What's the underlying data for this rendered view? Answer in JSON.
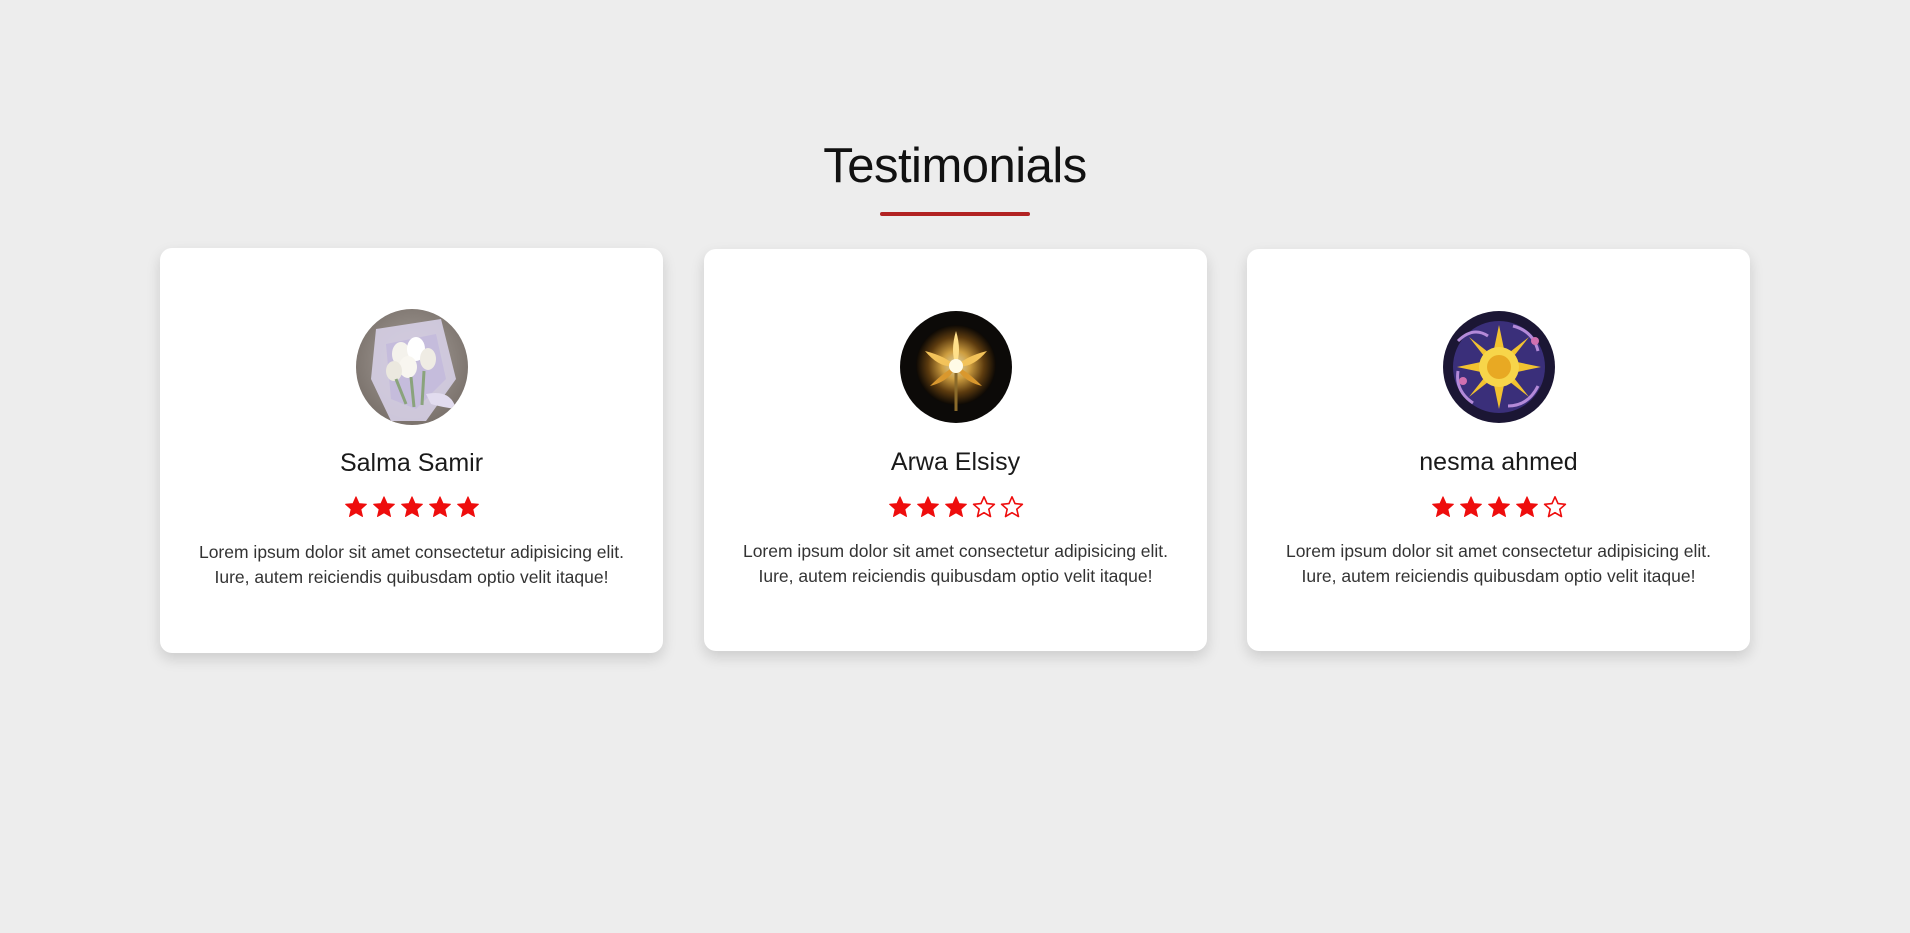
{
  "section": {
    "title": "Testimonials",
    "accent_color": "#b22222"
  },
  "star_color": "#ee0d0d",
  "testimonials": [
    {
      "name": "Salma Samir",
      "avatar_icon": "white-tulip-bouquet-photo",
      "rating": 5,
      "max_rating": 5,
      "text": "Lorem ipsum dolor sit amet consectetur adipisicing elit. Iure, autem reiciendis quibusdam optio velit itaque!"
    },
    {
      "name": "Arwa Elsisy",
      "avatar_icon": "glowing-golden-flower-photo",
      "rating": 3,
      "max_rating": 5,
      "text": "Lorem ipsum dolor sit amet consectetur adipisicing elit. Iure, autem reiciendis quibusdam optio velit itaque!"
    },
    {
      "name": "nesma ahmed",
      "avatar_icon": "golden-sun-on-purple-photo",
      "rating": 4,
      "max_rating": 5,
      "text": "Lorem ipsum dolor sit amet consectetur adipisicing elit. Iure, autem reiciendis quibusdam optio velit itaque!"
    }
  ]
}
